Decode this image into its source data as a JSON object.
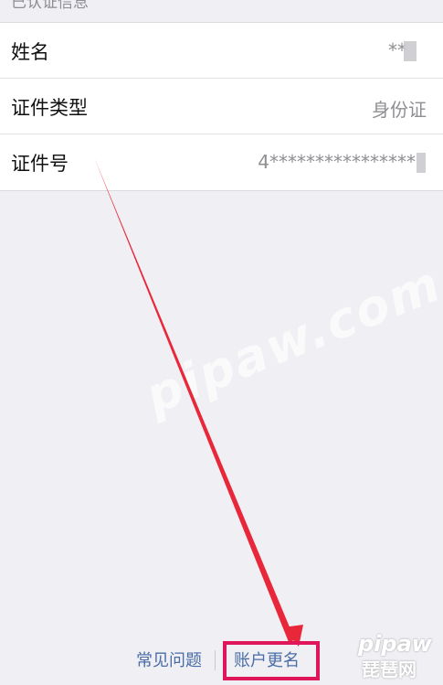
{
  "section_header": "已认证信息",
  "rows": [
    {
      "label": "姓名",
      "value": "**"
    },
    {
      "label": "证件类型",
      "value": "身份证"
    },
    {
      "label": "证件号",
      "value": "4****************"
    }
  ],
  "footer": {
    "faq_label": "常见问题",
    "rename_label": "账户更名"
  },
  "watermark": "pipaw.com",
  "brand": {
    "logo_text": "pipaw",
    "name": "琵琶网"
  },
  "colors": {
    "highlight": "#e0165b",
    "link": "#4a6da7",
    "arrow": "#e8283a"
  }
}
